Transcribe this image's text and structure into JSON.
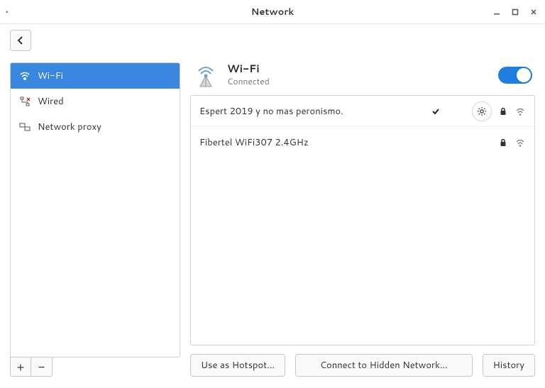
{
  "window": {
    "title": "Network"
  },
  "sidebar": {
    "items": [
      {
        "label": "Wi-Fi",
        "icon": "wifi-icon",
        "selected": true
      },
      {
        "label": "Wired",
        "icon": "wired-icon",
        "selected": false
      },
      {
        "label": "Network proxy",
        "icon": "proxy-icon",
        "selected": false
      }
    ],
    "add_label": "+",
    "remove_label": "−"
  },
  "panel": {
    "title": "Wi-Fi",
    "subtitle": "Connected",
    "toggle_on": true
  },
  "networks": [
    {
      "name": "Espert 2019 y no mas peronismo.",
      "connected": true,
      "secure": true
    },
    {
      "name": "Fibertel WiFi307 2.4GHz",
      "connected": false,
      "secure": true
    }
  ],
  "actions": {
    "hotspot": "Use as Hotspot...",
    "hidden": "Connect to Hidden Network...",
    "history": "History"
  }
}
